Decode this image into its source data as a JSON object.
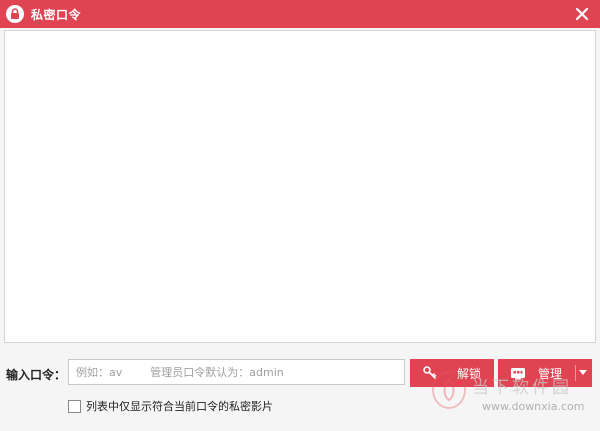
{
  "window": {
    "title": "私密口令",
    "title_icon": "lock-icon",
    "close_icon": "close-icon",
    "accent_color": "#e04452"
  },
  "password": {
    "label": "输入口令：",
    "placeholder_example": "例如：av",
    "placeholder_hint": "管理员口令默认为：admin",
    "value": ""
  },
  "buttons": {
    "unlock_label": "解锁",
    "unlock_icon": "key-icon",
    "manage_label": "管理",
    "manage_icon": "manage-icon",
    "dropdown_icon": "caret-down-icon"
  },
  "filter": {
    "label": "列表中仅显示符合当前口令的私密影片",
    "checked": false
  },
  "watermark": {
    "text": "当下软件园",
    "url": "www.downxia.com"
  }
}
